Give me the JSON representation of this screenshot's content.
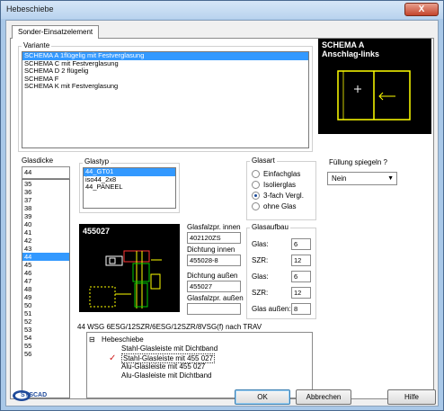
{
  "window": {
    "title": "Hebeschiebe",
    "close_glyph": "X"
  },
  "tab": {
    "label": "Sonder-Einsatzelement"
  },
  "variante": {
    "label": "Variante",
    "items": [
      "SCHEMA A 1flügelig  mit  Festverglasung",
      "SCHEMA C mit  Festverglasung",
      "SCHEMA D 2 flügelig",
      "SCHEMA F",
      "SCHEMA K mit  Festverglasung"
    ],
    "selected": 0
  },
  "schema_preview": {
    "line1": "SCHEMA A",
    "line2": "Anschlag-links"
  },
  "glasdicke": {
    "label": "Glasdicke",
    "value": "44",
    "items": [
      "35",
      "36",
      "37",
      "38",
      "39",
      "40",
      "41",
      "42",
      "43",
      "44",
      "45",
      "46",
      "47",
      "48",
      "49",
      "50",
      "51",
      "52",
      "53",
      "54",
      "55",
      "56"
    ],
    "selected": 9
  },
  "glastyp": {
    "label": "Glastyp",
    "items": [
      "44_GT01",
      "iso44_2x8",
      "44_PANEEL"
    ],
    "selected": 0
  },
  "glasart": {
    "label": "Glasart",
    "options": [
      "Einfachglas",
      "Isolierglas",
      "3-fach Vergl.",
      "ohne Glas"
    ],
    "selected": 2
  },
  "fuellung": {
    "label": "Füllung spiegeln ?",
    "value": "Nein"
  },
  "profile_preview": {
    "code": "455027"
  },
  "glasfalzpr_innen": {
    "label": "Glasfalzpr. innen",
    "value": "402120ZS"
  },
  "dichtung_innen": {
    "label": "Dichtung innen",
    "value": "455028-8"
  },
  "dichtung_aussen": {
    "label": "Dichtung außen",
    "value": "455027"
  },
  "glasfalzpr_aussen": {
    "label": "Glasfalzpr. außen",
    "value": ""
  },
  "glasaufbau": {
    "label": "Glasaufbau",
    "rows": [
      {
        "label": "Glas:",
        "value": "6"
      },
      {
        "label": "SZR:",
        "value": "12"
      },
      {
        "label": "Glas:",
        "value": "6"
      },
      {
        "label": "SZR:",
        "value": "12"
      },
      {
        "label": "Glas außen:",
        "value": "8"
      }
    ]
  },
  "description": "44 WSG 6ESG/12SZR/6ESG/12SZR/8VSG(f) nach TRAV",
  "tree": {
    "root": "Hebeschiebe",
    "expander": "⊟",
    "items": [
      {
        "label": "Stahl-Glasleiste  mit  Dichtband",
        "checked": false,
        "selected": false
      },
      {
        "label": "Stahl-Glasleiste  mit  455 027",
        "checked": true,
        "selected": true
      },
      {
        "label": "Alu-Glasleiste  mit  455 027",
        "checked": false,
        "selected": false
      },
      {
        "label": "Alu-Glasleiste  mit  Dichtband",
        "checked": false,
        "selected": false
      }
    ],
    "check_glyph": "✓"
  },
  "logo": {
    "text": "SYSCAD"
  },
  "buttons": {
    "ok": "OK",
    "cancel": "Abbrechen",
    "help": "Hilfe"
  },
  "colors": {
    "selection": "#3399ff",
    "preview_line": "#ffff00",
    "preview_green": "#00cc00",
    "preview_bg": "#000000"
  }
}
